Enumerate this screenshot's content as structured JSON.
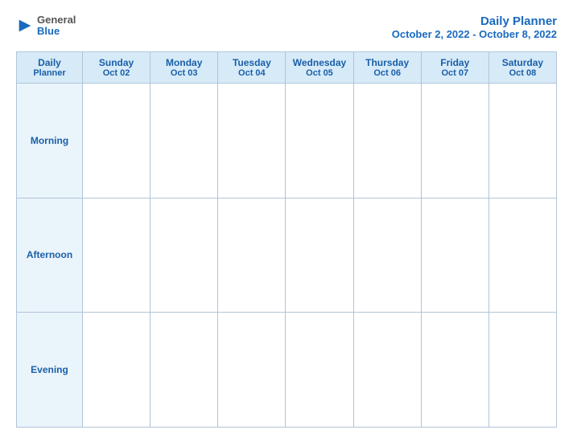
{
  "logo": {
    "general": "General",
    "blue": "Blue",
    "icon": "▶"
  },
  "header": {
    "title": "Daily Planner",
    "date_range": "October 2, 2022 - October 8, 2022"
  },
  "table": {
    "label_col": {
      "header_line1": "Daily",
      "header_line2": "Planner"
    },
    "columns": [
      {
        "day": "Sunday",
        "date": "Oct 02"
      },
      {
        "day": "Monday",
        "date": "Oct 03"
      },
      {
        "day": "Tuesday",
        "date": "Oct 04"
      },
      {
        "day": "Wednesday",
        "date": "Oct 05"
      },
      {
        "day": "Thursday",
        "date": "Oct 06"
      },
      {
        "day": "Friday",
        "date": "Oct 07"
      },
      {
        "day": "Saturday",
        "date": "Oct 08"
      }
    ],
    "rows": [
      {
        "label": "Morning"
      },
      {
        "label": "Afternoon"
      },
      {
        "label": "Evening"
      }
    ]
  }
}
